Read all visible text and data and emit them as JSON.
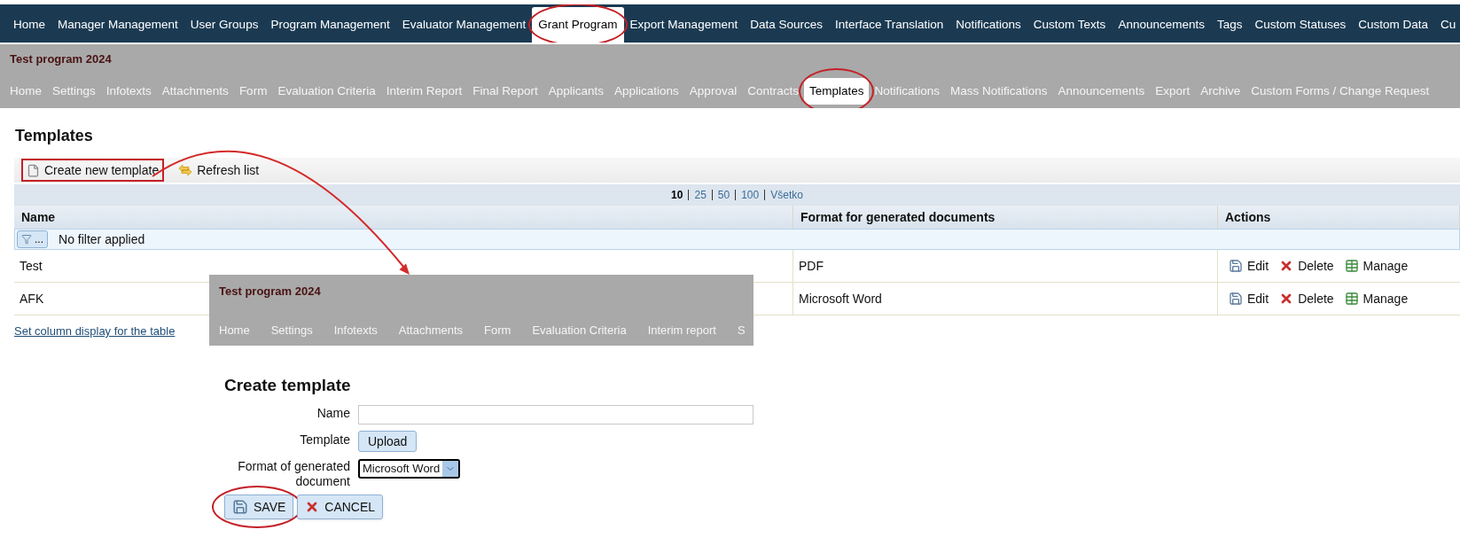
{
  "top_nav": [
    {
      "label": "Home",
      "selected": false,
      "circled": false
    },
    {
      "label": "Manager Management",
      "selected": false,
      "circled": false
    },
    {
      "label": "User Groups",
      "selected": false,
      "circled": false
    },
    {
      "label": "Program Management",
      "selected": false,
      "circled": false
    },
    {
      "label": "Evaluator Management",
      "selected": false,
      "circled": false
    },
    {
      "label": "Grant Program",
      "selected": true,
      "circled": true
    },
    {
      "label": "Export Management",
      "selected": false,
      "circled": false
    },
    {
      "label": "Data Sources",
      "selected": false,
      "circled": false
    },
    {
      "label": "Interface Translation",
      "selected": false,
      "circled": false
    },
    {
      "label": "Notifications",
      "selected": false,
      "circled": false
    },
    {
      "label": "Custom Texts",
      "selected": false,
      "circled": false
    },
    {
      "label": "Announcements",
      "selected": false,
      "circled": false
    },
    {
      "label": "Tags",
      "selected": false,
      "circled": false
    },
    {
      "label": "Custom Statuses",
      "selected": false,
      "circled": false
    },
    {
      "label": "Custom Data",
      "selected": false,
      "circled": false
    },
    {
      "label": "Cu",
      "selected": false,
      "circled": false
    }
  ],
  "program_bar": {
    "title": "Test program 2024",
    "tabs": [
      {
        "label": "Home",
        "selected": false,
        "circled": false
      },
      {
        "label": "Settings",
        "selected": false,
        "circled": false
      },
      {
        "label": "Infotexts",
        "selected": false,
        "circled": false
      },
      {
        "label": "Attachments",
        "selected": false,
        "circled": false
      },
      {
        "label": "Form",
        "selected": false,
        "circled": false
      },
      {
        "label": "Evaluation Criteria",
        "selected": false,
        "circled": false
      },
      {
        "label": "Interim Report",
        "selected": false,
        "circled": false
      },
      {
        "label": "Final Report",
        "selected": false,
        "circled": false
      },
      {
        "label": "Applicants",
        "selected": false,
        "circled": false
      },
      {
        "label": "Applications",
        "selected": false,
        "circled": false
      },
      {
        "label": "Approval",
        "selected": false,
        "circled": false
      },
      {
        "label": "Contracts",
        "selected": false,
        "circled": false
      },
      {
        "label": "Templates",
        "selected": true,
        "circled": true
      },
      {
        "label": "Notifications",
        "selected": false,
        "circled": false
      },
      {
        "label": "Mass Notifications",
        "selected": false,
        "circled": false
      },
      {
        "label": "Announcements",
        "selected": false,
        "circled": false
      },
      {
        "label": "Export",
        "selected": false,
        "circled": false
      },
      {
        "label": "Archive",
        "selected": false,
        "circled": false
      },
      {
        "label": "Custom Forms / Change Request",
        "selected": false,
        "circled": false
      }
    ]
  },
  "page_title": "Templates",
  "toolbar": [
    {
      "label": "Create new template",
      "kind": "new",
      "boxed": true
    },
    {
      "label": "Refresh list",
      "kind": "refresh",
      "boxed": false
    }
  ],
  "pager": [
    {
      "label": "10",
      "selected": true
    },
    {
      "label": "25",
      "selected": false
    },
    {
      "label": "50",
      "selected": false
    },
    {
      "label": "100",
      "selected": false
    },
    {
      "label": "Všetko",
      "selected": false
    }
  ],
  "table": {
    "columns": [
      "Name",
      "Format for generated documents",
      "Actions"
    ],
    "filter": {
      "button": "...",
      "text": "No filter applied"
    },
    "rows": [
      {
        "name": "Test",
        "format": "PDF",
        "actions": [
          {
            "label": "Edit",
            "kind": "edit"
          },
          {
            "label": "Delete",
            "kind": "delete"
          },
          {
            "label": "Manage",
            "kind": "manage"
          }
        ]
      },
      {
        "name": "AFK",
        "format": "Microsoft Word",
        "actions": [
          {
            "label": "Edit",
            "kind": "edit"
          },
          {
            "label": "Delete",
            "kind": "delete"
          },
          {
            "label": "Manage",
            "kind": "manage"
          }
        ]
      }
    ]
  },
  "column_link": "Set column display for the table",
  "inset_bar": {
    "title": "Test program 2024",
    "tabs": [
      "Home",
      "Settings",
      "Infotexts",
      "Attachments",
      "Form",
      "Evaluation Criteria",
      "Interim report",
      "S"
    ]
  },
  "create_form": {
    "title": "Create template",
    "fields": [
      {
        "label": "Name",
        "kind": "text"
      },
      {
        "label": "Template",
        "kind": "upload",
        "button": "Upload"
      },
      {
        "label": "Format of generated document",
        "kind": "select",
        "value": "Microsoft Word"
      }
    ],
    "buttons": [
      {
        "label": "SAVE",
        "kind": "save",
        "circled": true
      },
      {
        "label": "CANCEL",
        "kind": "cancel",
        "circled": false
      }
    ]
  }
}
